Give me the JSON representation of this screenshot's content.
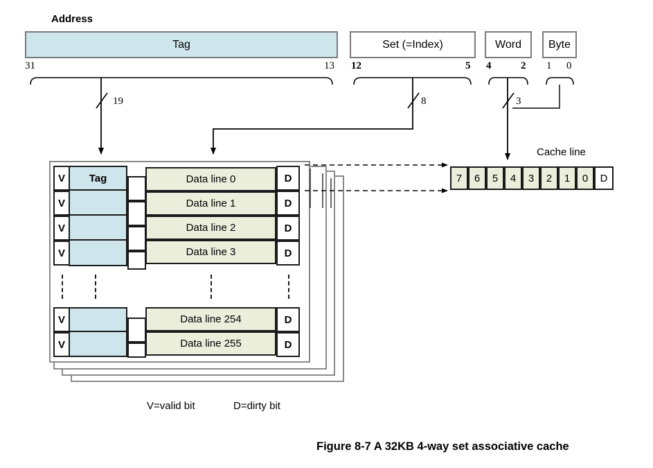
{
  "figure": {
    "caption": "Figure 8-7 A 32KB 4-way set associative cache",
    "legend": {
      "valid": "V=valid bit",
      "dirty": "D=dirty bit"
    }
  },
  "address": {
    "title": "Address",
    "fields": [
      {
        "name": "tag",
        "label": "Tag",
        "hi": "31",
        "lo": "13",
        "width_label": "19"
      },
      {
        "name": "set",
        "label": "Set (=Index)",
        "hi": "12",
        "lo": "5",
        "width_label": "8"
      },
      {
        "name": "word",
        "label": "Word",
        "hi": "4",
        "lo": "2",
        "width_label": "3"
      },
      {
        "name": "byte",
        "label": "Byte",
        "hi": "1",
        "lo": "0",
        "width_label": ""
      }
    ]
  },
  "cache_array": {
    "ways": 4,
    "columns": {
      "valid": "V",
      "tag": "Tag",
      "dirty": "D"
    },
    "rows": [
      {
        "valid": "V",
        "data": "Data line 0"
      },
      {
        "valid": "V",
        "data": "Data line 1"
      },
      {
        "valid": "V",
        "data": "Data line 2"
      },
      {
        "valid": "V",
        "data": "Data line 3"
      },
      {
        "valid": "V",
        "data": "Data line 254"
      },
      {
        "valid": "V",
        "data": "Data line 255"
      }
    ]
  },
  "cache_line": {
    "title": "Cache line",
    "words": [
      "7",
      "6",
      "5",
      "4",
      "3",
      "2",
      "1",
      "0"
    ],
    "dirty": "D"
  },
  "colors": {
    "tag_fill": "#cfe5ec",
    "data_fill": "#eaeedb",
    "box_border": "#7a7a7a",
    "cell_border": "#1a1a1a",
    "layer_border": "#8a8a8a"
  }
}
